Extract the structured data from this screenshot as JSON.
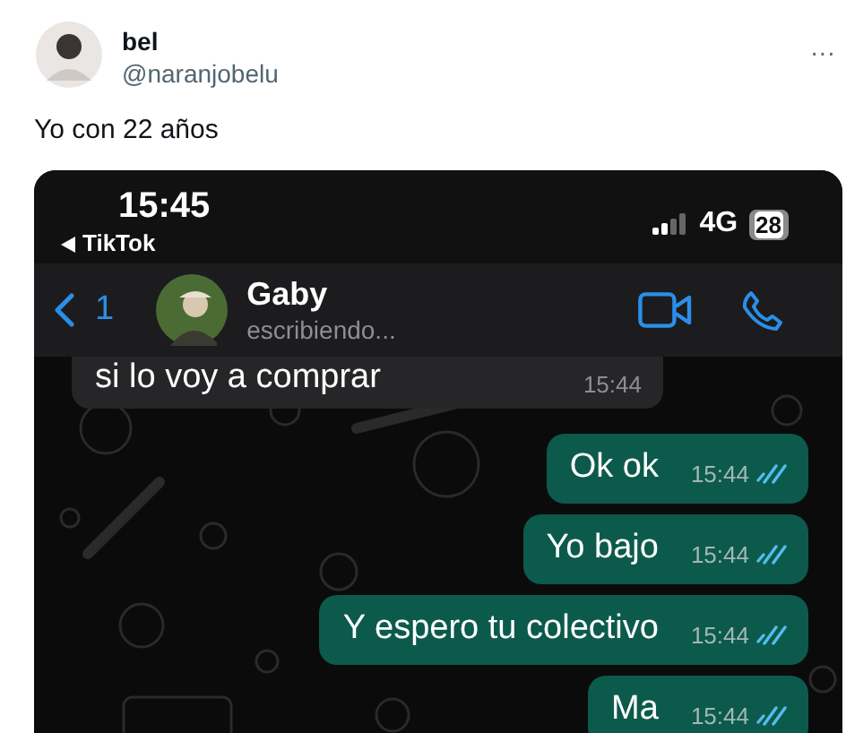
{
  "post": {
    "author": {
      "name": "bel",
      "handle": "@naranjobelu"
    },
    "more": "···",
    "text": "Yo con 22 años"
  },
  "phone": {
    "status_bar": {
      "time": "15:45",
      "back_app": "TikTok",
      "network": "4G",
      "battery": "28"
    },
    "chat_header": {
      "back_count": "1",
      "contact": "Gaby",
      "status": "escribiendo..."
    },
    "messages": [
      {
        "kind": "incoming",
        "text": "si lo voy a comprar",
        "time": "15:44"
      },
      {
        "kind": "outgoing",
        "text": "Ok ok",
        "time": "15:44",
        "read": true
      },
      {
        "kind": "outgoing",
        "text": "Yo bajo",
        "time": "15:44",
        "read": true
      },
      {
        "kind": "outgoing",
        "text": "Y espero tu colectivo",
        "time": "15:44",
        "read": true
      },
      {
        "kind": "outgoing",
        "text": "Ma",
        "time": "15:44",
        "read": true
      }
    ]
  }
}
